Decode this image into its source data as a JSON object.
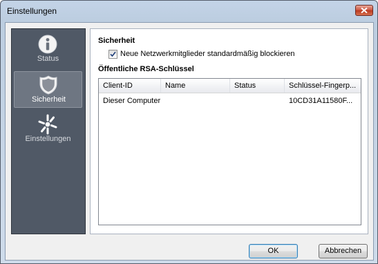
{
  "window": {
    "title": "Einstellungen"
  },
  "sidebar": {
    "items": [
      {
        "label": "Status",
        "icon": "info-icon",
        "active": false
      },
      {
        "label": "Sicherheit",
        "icon": "shield-icon",
        "active": true
      },
      {
        "label": "Einstellungen",
        "icon": "settings-spark-icon",
        "active": false
      }
    ]
  },
  "security": {
    "heading": "Sicherheit",
    "block_new_members": {
      "label": "Neue Netzwerkmitglieder standardmäßig blockieren",
      "checked": true
    },
    "rsa_heading": "Öffentliche RSA-Schlüssel",
    "table": {
      "columns": [
        "Client-ID",
        "Name",
        "Status",
        "Schlüssel-Fingerp..."
      ],
      "rows": [
        [
          "Dieser Computer",
          "",
          "",
          "10CD31A11580F..."
        ]
      ]
    }
  },
  "buttons": {
    "ok": "OK",
    "cancel": "Abbrechen"
  },
  "colors": {
    "sidebar_bg": "#505966",
    "sidebar_active": "#6e7682",
    "close_red": "#c9513b"
  }
}
